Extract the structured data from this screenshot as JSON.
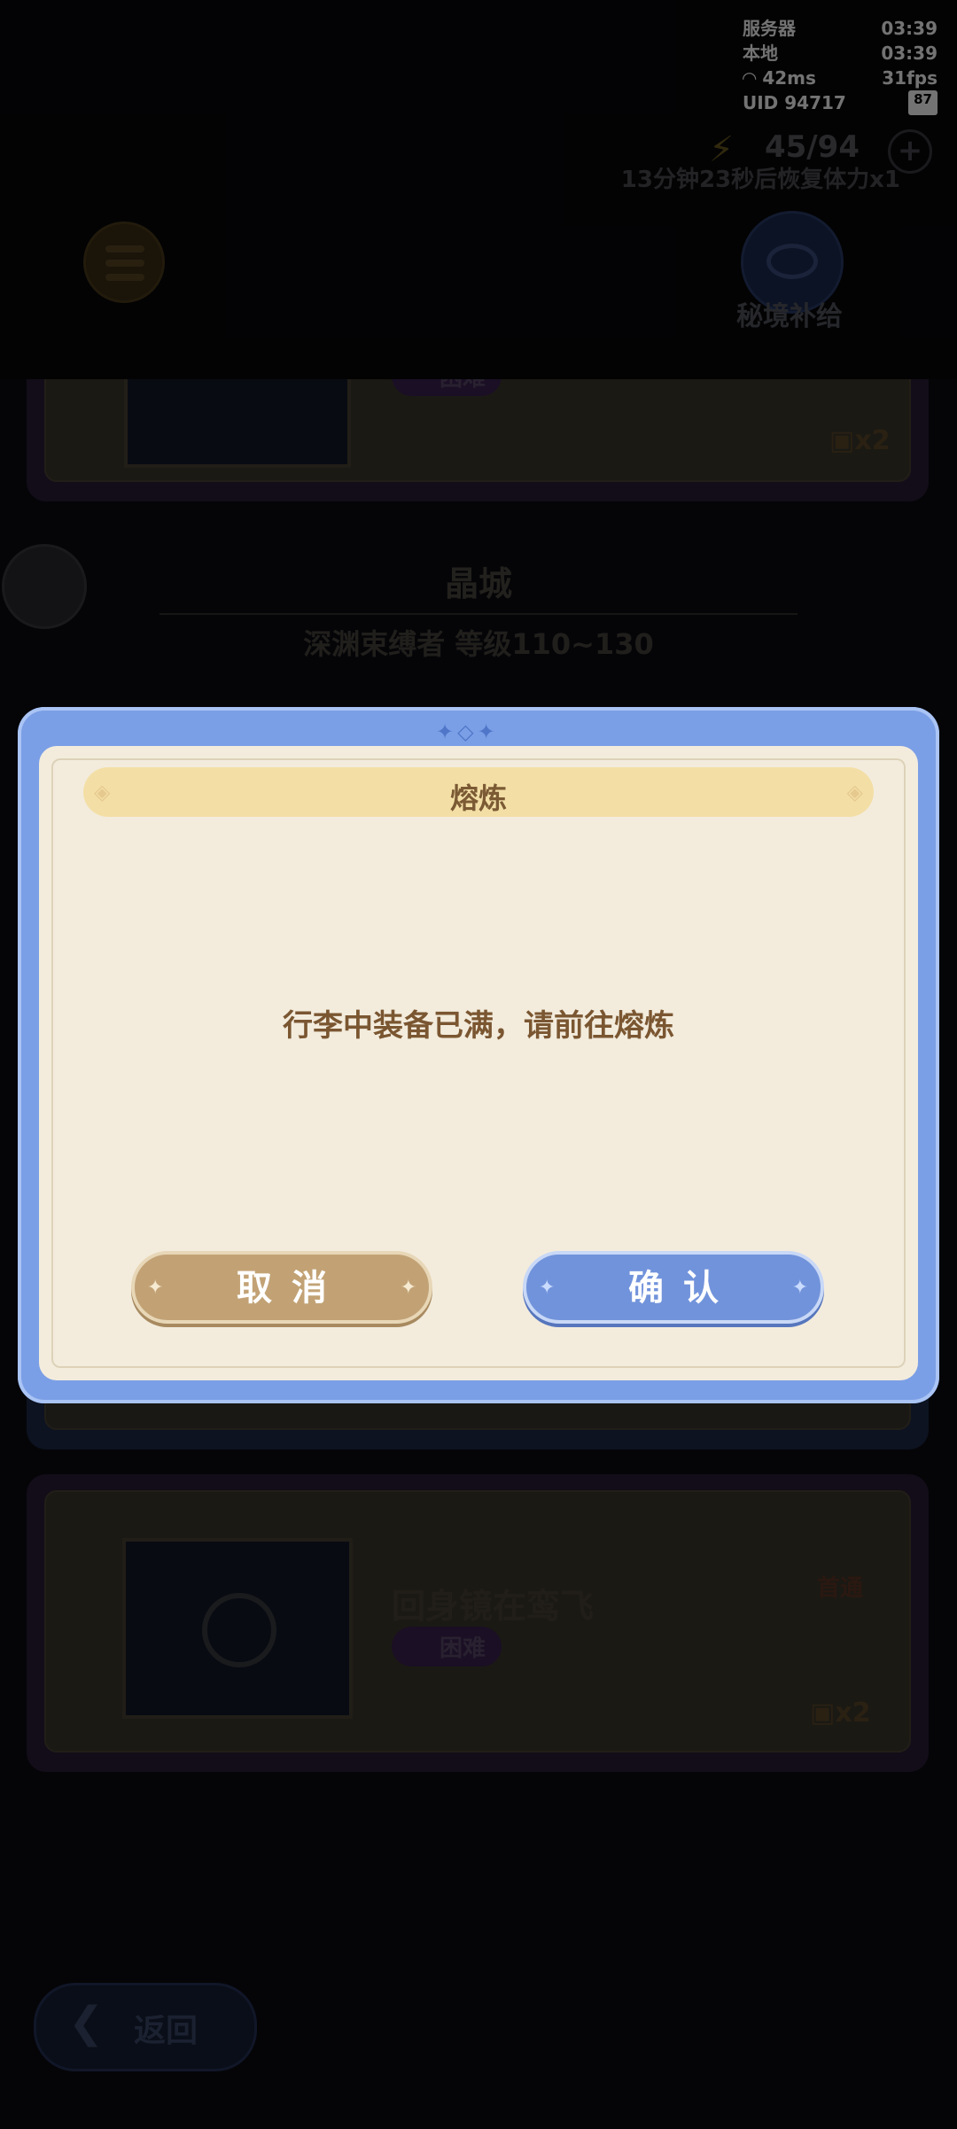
{
  "status": {
    "server_label": "服务器",
    "server_time": "03:39",
    "local_label": "本地",
    "local_time": "03:39",
    "ping": "42ms",
    "fps": "31fps",
    "uid": "UID  94717",
    "battery": "87"
  },
  "topbar": {
    "energy": "45/94",
    "recover_text": "13分钟23秒后恢复体力x1",
    "supply_label": "秘境补给"
  },
  "region": {
    "title": "晶城",
    "subtitle": "深渊束缚者  等级110~130"
  },
  "cards": [
    {
      "tag": "困难",
      "chest": "x2"
    },
    {
      "title": "回身镜在鸾飞",
      "tag": "困难",
      "chest": "x2",
      "badge": "首通"
    }
  ],
  "back_label": "返回",
  "dialog": {
    "title": "熔炼",
    "message": "行李中装备已满，请前往熔炼",
    "cancel_label": "取消",
    "confirm_label": "确认"
  },
  "colors": {
    "dialog_frame": "#7b9fe6",
    "dialog_panel": "#f3ecdd",
    "cancel_button": "#c2a275",
    "confirm_button": "#7193db"
  }
}
